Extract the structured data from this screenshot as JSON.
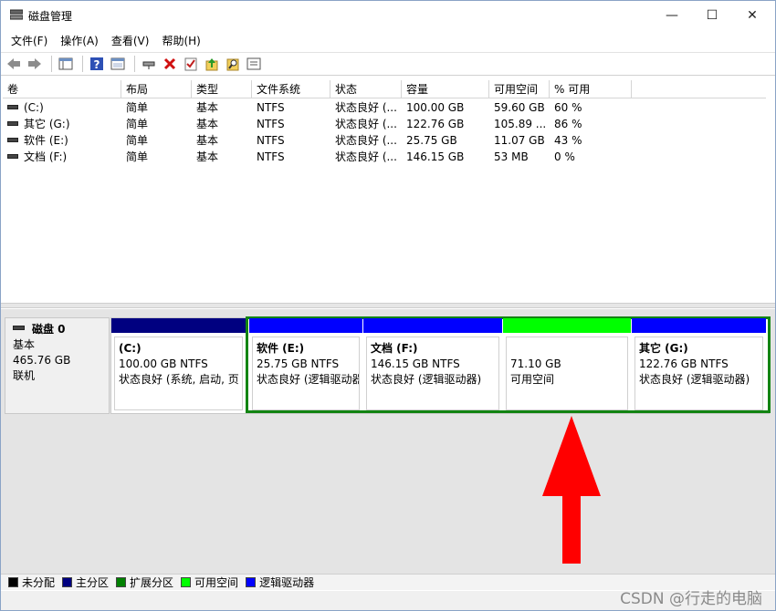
{
  "window": {
    "title": "磁盘管理",
    "controls": {
      "minimize": "—",
      "maximize": "☐",
      "close": "✕"
    }
  },
  "menu": [
    "文件(F)",
    "操作(A)",
    "查看(V)",
    "帮助(H)"
  ],
  "toolbar": [
    "back-icon",
    "forward-icon",
    "console-tree-icon",
    "help-icon",
    "view-icon",
    "connect-icon",
    "delete-icon",
    "check-icon",
    "up-icon",
    "search-icon",
    "properties-icon"
  ],
  "volume_list": {
    "columns": [
      "卷",
      "布局",
      "类型",
      "文件系统",
      "状态",
      "容量",
      "可用空间",
      "% 可用"
    ],
    "rows": [
      [
        "(C:)",
        "简单",
        "基本",
        "NTFS",
        "状态良好 (...",
        "100.00 GB",
        "59.60 GB",
        "60 %"
      ],
      [
        "其它 (G:)",
        "简单",
        "基本",
        "NTFS",
        "状态良好 (...",
        "122.76 GB",
        "105.89 ...",
        "86 %"
      ],
      [
        "软件 (E:)",
        "简单",
        "基本",
        "NTFS",
        "状态良好 (...",
        "25.75 GB",
        "11.07 GB",
        "43 %"
      ],
      [
        "文档 (F:)",
        "简单",
        "基本",
        "NTFS",
        "状态良好 (...",
        "146.15 GB",
        "53 MB",
        "0 %"
      ]
    ]
  },
  "disk": {
    "name": "磁盘 0",
    "type": "基本",
    "size": "465.76 GB",
    "status": "联机"
  },
  "partitions": [
    {
      "name": "(C:)",
      "size": "100.00 GB NTFS",
      "status": "状态良好 (系统, 启动, 页",
      "color": "#000080"
    },
    {
      "name": "软件  (E:)",
      "size": "25.75 GB NTFS",
      "status": "状态良好 (逻辑驱动器",
      "color": "#0000ff"
    },
    {
      "name": "文档  (F:)",
      "size": "146.15 GB NTFS",
      "status": "状态良好 (逻辑驱动器)",
      "color": "#0000ff"
    },
    {
      "name": "",
      "size": "71.10 GB",
      "status": "可用空间",
      "color": "#00ff00"
    },
    {
      "name": "其它  (G:)",
      "size": "122.76 GB NTFS",
      "status": "状态良好 (逻辑驱动器)",
      "color": "#0000ff"
    }
  ],
  "legend": [
    {
      "label": "未分配",
      "color": "#000000"
    },
    {
      "label": "主分区",
      "color": "#000080"
    },
    {
      "label": "扩展分区",
      "color": "#008000"
    },
    {
      "label": "可用空间",
      "color": "#00ff00"
    },
    {
      "label": "逻辑驱动器",
      "color": "#0000ff"
    }
  ],
  "watermark": "CSDN @行走的电脑",
  "annotation_arrow_color": "#ff0000"
}
